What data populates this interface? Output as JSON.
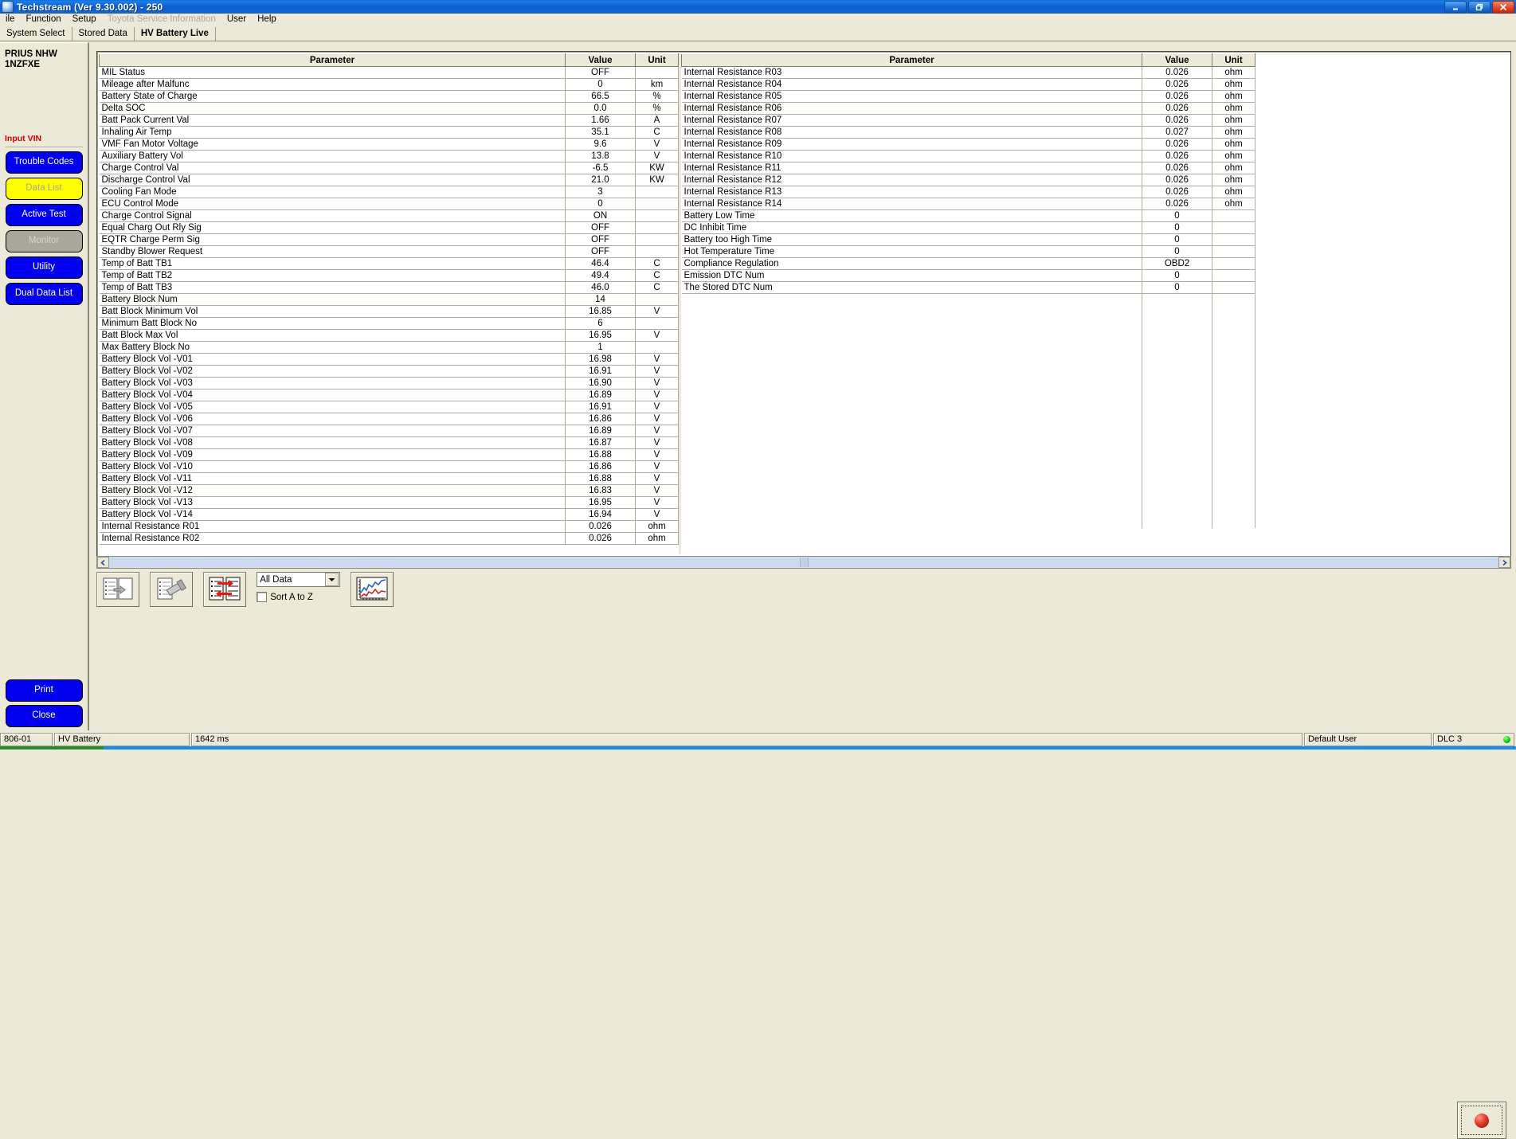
{
  "window": {
    "title": "Techstream (Ver 9.30.002) - 250",
    "minimize_label": "Minimize",
    "restore_label": "Restore",
    "close_label": "Close"
  },
  "menu": {
    "items": [
      {
        "label": "ile",
        "disabled": false
      },
      {
        "label": "Function",
        "disabled": false
      },
      {
        "label": "Setup",
        "disabled": false
      },
      {
        "label": "Toyota Service Information",
        "disabled": true
      },
      {
        "label": "User",
        "disabled": false
      },
      {
        "label": "Help",
        "disabled": false
      }
    ]
  },
  "tabs": [
    {
      "label": "System Select",
      "active": false
    },
    {
      "label": "Stored Data",
      "active": false
    },
    {
      "label": "HV Battery Live",
      "active": true
    }
  ],
  "sidebar": {
    "vehicle_line1": "PRIUS NHW",
    "vehicle_line2": "1NZFXE",
    "input_vin": "Input VIN",
    "buttons": [
      {
        "label": "Trouble Codes",
        "style": "blue"
      },
      {
        "label": "Data List",
        "style": "yellow"
      },
      {
        "label": "Active Test",
        "style": "blue"
      },
      {
        "label": "Monitor",
        "style": "gray"
      },
      {
        "label": "Utility",
        "style": "blue"
      },
      {
        "label": "Dual Data List",
        "style": "blue"
      }
    ],
    "bottom_buttons": [
      {
        "label": "Print",
        "style": "blue"
      },
      {
        "label": "Close",
        "style": "blue"
      }
    ]
  },
  "table": {
    "headers": {
      "parameter": "Parameter",
      "value": "Value",
      "unit": "Unit"
    },
    "left_rows": [
      {
        "parameter": "MIL Status",
        "value": "OFF",
        "unit": ""
      },
      {
        "parameter": "Mileage after Malfunc",
        "value": "0",
        "unit": "km"
      },
      {
        "parameter": "Battery State of Charge",
        "value": "66.5",
        "unit": "%"
      },
      {
        "parameter": "Delta SOC",
        "value": "0.0",
        "unit": "%"
      },
      {
        "parameter": "Batt Pack Current Val",
        "value": "1.66",
        "unit": "A"
      },
      {
        "parameter": "Inhaling Air Temp",
        "value": "35.1",
        "unit": "C"
      },
      {
        "parameter": "VMF Fan Motor Voltage",
        "value": "9.6",
        "unit": "V"
      },
      {
        "parameter": "Auxiliary Battery Vol",
        "value": "13.8",
        "unit": "V"
      },
      {
        "parameter": "Charge Control Val",
        "value": "-6.5",
        "unit": "KW"
      },
      {
        "parameter": "Discharge Control Val",
        "value": "21.0",
        "unit": "KW"
      },
      {
        "parameter": "Cooling Fan Mode",
        "value": "3",
        "unit": ""
      },
      {
        "parameter": "ECU Control Mode",
        "value": "0",
        "unit": ""
      },
      {
        "parameter": "Charge Control Signal",
        "value": "ON",
        "unit": ""
      },
      {
        "parameter": "Equal Charg Out Rly Sig",
        "value": "OFF",
        "unit": ""
      },
      {
        "parameter": "EQTR Charge Perm Sig",
        "value": "OFF",
        "unit": ""
      },
      {
        "parameter": "Standby Blower Request",
        "value": "OFF",
        "unit": ""
      },
      {
        "parameter": "Temp of Batt TB1",
        "value": "46.4",
        "unit": "C"
      },
      {
        "parameter": "Temp of Batt TB2",
        "value": "49.4",
        "unit": "C"
      },
      {
        "parameter": "Temp of Batt TB3",
        "value": "46.0",
        "unit": "C"
      },
      {
        "parameter": "Battery Block Num",
        "value": "14",
        "unit": ""
      },
      {
        "parameter": "Batt Block Minimum Vol",
        "value": "16.85",
        "unit": "V"
      },
      {
        "parameter": "Minimum Batt Block No",
        "value": "6",
        "unit": ""
      },
      {
        "parameter": "Batt Block Max Vol",
        "value": "16.95",
        "unit": "V"
      },
      {
        "parameter": "Max Battery Block No",
        "value": "1",
        "unit": ""
      },
      {
        "parameter": "Battery Block Vol -V01",
        "value": "16.98",
        "unit": "V"
      },
      {
        "parameter": "Battery Block Vol -V02",
        "value": "16.91",
        "unit": "V"
      },
      {
        "parameter": "Battery Block Vol -V03",
        "value": "16.90",
        "unit": "V"
      },
      {
        "parameter": "Battery Block Vol -V04",
        "value": "16.89",
        "unit": "V"
      },
      {
        "parameter": "Battery Block Vol -V05",
        "value": "16.91",
        "unit": "V"
      },
      {
        "parameter": "Battery Block Vol -V06",
        "value": "16.86",
        "unit": "V"
      },
      {
        "parameter": "Battery Block Vol -V07",
        "value": "16.89",
        "unit": "V"
      },
      {
        "parameter": "Battery Block Vol -V08",
        "value": "16.87",
        "unit": "V"
      },
      {
        "parameter": "Battery Block Vol -V09",
        "value": "16.88",
        "unit": "V"
      },
      {
        "parameter": "Battery Block Vol -V10",
        "value": "16.86",
        "unit": "V"
      },
      {
        "parameter": "Battery Block Vol -V11",
        "value": "16.88",
        "unit": "V"
      },
      {
        "parameter": "Battery Block Vol -V12",
        "value": "16.83",
        "unit": "V"
      },
      {
        "parameter": "Battery Block Vol -V13",
        "value": "16.95",
        "unit": "V"
      },
      {
        "parameter": "Battery Block Vol -V14",
        "value": "16.94",
        "unit": "V"
      },
      {
        "parameter": "Internal Resistance R01",
        "value": "0.026",
        "unit": "ohm"
      },
      {
        "parameter": "Internal Resistance R02",
        "value": "0.026",
        "unit": "ohm"
      }
    ],
    "right_rows": [
      {
        "parameter": "Internal Resistance R03",
        "value": "0.026",
        "unit": "ohm"
      },
      {
        "parameter": "Internal Resistance R04",
        "value": "0.026",
        "unit": "ohm"
      },
      {
        "parameter": "Internal Resistance R05",
        "value": "0.026",
        "unit": "ohm"
      },
      {
        "parameter": "Internal Resistance R06",
        "value": "0.026",
        "unit": "ohm"
      },
      {
        "parameter": "Internal Resistance R07",
        "value": "0.026",
        "unit": "ohm"
      },
      {
        "parameter": "Internal Resistance R08",
        "value": "0.027",
        "unit": "ohm"
      },
      {
        "parameter": "Internal Resistance R09",
        "value": "0.026",
        "unit": "ohm"
      },
      {
        "parameter": "Internal Resistance R10",
        "value": "0.026",
        "unit": "ohm"
      },
      {
        "parameter": "Internal Resistance R11",
        "value": "0.026",
        "unit": "ohm"
      },
      {
        "parameter": "Internal Resistance R12",
        "value": "0.026",
        "unit": "ohm"
      },
      {
        "parameter": "Internal Resistance R13",
        "value": "0.026",
        "unit": "ohm"
      },
      {
        "parameter": "Internal Resistance R14",
        "value": "0.026",
        "unit": "ohm"
      },
      {
        "parameter": "Battery Low Time",
        "value": "0",
        "unit": ""
      },
      {
        "parameter": "DC Inhibit Time",
        "value": "0",
        "unit": ""
      },
      {
        "parameter": "Battery too High Time",
        "value": "0",
        "unit": ""
      },
      {
        "parameter": "Hot Temperature Time",
        "value": "0",
        "unit": ""
      },
      {
        "parameter": "Compliance Regulation",
        "value": "OBD2",
        "unit": ""
      },
      {
        "parameter": "Emission DTC Num",
        "value": "0",
        "unit": ""
      },
      {
        "parameter": "The Stored DTC Num",
        "value": "0",
        "unit": ""
      }
    ]
  },
  "toolbar": {
    "select_current": "All Data",
    "sort_label": "Sort A to Z",
    "sort_checked": false,
    "buttons": [
      {
        "name": "move-items-icon",
        "title": "Select Items"
      },
      {
        "name": "snapshot-icon",
        "title": "Snapshot"
      },
      {
        "name": "swap-items-icon",
        "title": "Swap"
      },
      {
        "name": "graph-icon",
        "title": "Graph"
      }
    ],
    "record_label": "Record"
  },
  "statusbar": {
    "code": "806-01",
    "system": "HV Battery",
    "rate": "1642 ms",
    "user": "Default User",
    "connection": "DLC 3"
  },
  "colors": {
    "titlebar": "#0b5fd0",
    "button_blue": "#0000ee",
    "button_yellow": "#ffff00",
    "accent_red": "#d00000",
    "status_green": "#00cc00"
  }
}
